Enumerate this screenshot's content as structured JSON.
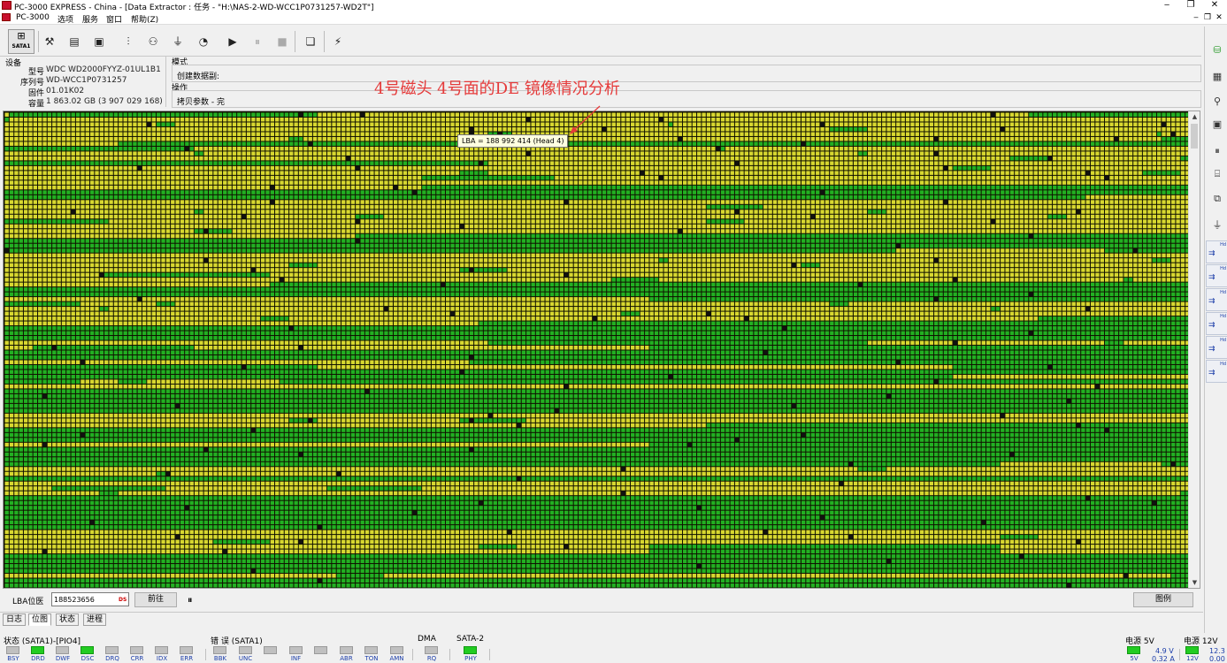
{
  "window": {
    "title": "PC-3000 EXPRESS - China - [Data Extractor : 任务 - \"H:\\NAS-2-WD-WCC1P0731257-WD2T\"]",
    "controls": [
      "‒",
      "❐",
      "✕"
    ],
    "mdi_controls": [
      "‒",
      "❐",
      "✕"
    ]
  },
  "menu": [
    "PC-3000",
    "选项",
    "服务",
    "窗口",
    "帮助(Z)"
  ],
  "toolbar": {
    "sata_label": "SATA1",
    "buttons": [
      "sata-port",
      "tools",
      "bios",
      "100-percent",
      "drive-pin",
      "search",
      "jumper",
      "disk-image",
      "play",
      "pause",
      "stop",
      "window-list",
      "run-script"
    ]
  },
  "device": {
    "header": "设备",
    "rows": [
      {
        "label": "型号",
        "value": "WDC WD2000FYYZ-01UL1B1"
      },
      {
        "label": "序列号",
        "value": "WD-WCC1P0731257"
      },
      {
        "label": "固件",
        "value": "01.01K02"
      },
      {
        "label": "容量",
        "value": "1 863.02 GB (3 907 029 168)"
      }
    ]
  },
  "mode": {
    "header": "模式",
    "value": "创建数据副:"
  },
  "operation": {
    "header": "操作",
    "value": "拷贝参数 - 完"
  },
  "annotation": "4号磁头 4号面的DE 镜像情况分析",
  "tooltip": "LBA =  188 992 414 (Head 4)",
  "sector_map": {
    "columns": 250,
    "rows": 98,
    "legend": {
      "read_ok": "#d8d830",
      "read_green": "#22b022",
      "bad": "#111111",
      "grid": "#101000"
    },
    "green_runs": [
      [
        0,
        1,
        66
      ],
      [
        0,
        216,
        250
      ],
      [
        1,
        0,
        1
      ],
      [
        2,
        32,
        36
      ],
      [
        2,
        140,
        141
      ],
      [
        3,
        174,
        182
      ],
      [
        4,
        102,
        107
      ],
      [
        4,
        243,
        244
      ],
      [
        5,
        60,
        63
      ],
      [
        5,
        244,
        250
      ],
      [
        6,
        24,
        250
      ],
      [
        7,
        0,
        40
      ],
      [
        7,
        151,
        152
      ],
      [
        8,
        40,
        42
      ],
      [
        8,
        180,
        182
      ],
      [
        9,
        212,
        220
      ],
      [
        9,
        248,
        250
      ],
      [
        10,
        0,
        102
      ],
      [
        11,
        200,
        208
      ],
      [
        12,
        96,
        102
      ],
      [
        12,
        240,
        248
      ],
      [
        13,
        88,
        116
      ],
      [
        15,
        88,
        250
      ],
      [
        16,
        0,
        250
      ],
      [
        17,
        0,
        228
      ],
      [
        19,
        148,
        160
      ],
      [
        20,
        40,
        42
      ],
      [
        20,
        182,
        186
      ],
      [
        21,
        74,
        80
      ],
      [
        21,
        220,
        224
      ],
      [
        22,
        0,
        22
      ],
      [
        22,
        148,
        156
      ],
      [
        24,
        40,
        48
      ],
      [
        25,
        74,
        250
      ],
      [
        26,
        0,
        250
      ],
      [
        27,
        0,
        250
      ],
      [
        28,
        0,
        188
      ],
      [
        28,
        232,
        250
      ],
      [
        30,
        138,
        140
      ],
      [
        30,
        242,
        246
      ],
      [
        31,
        60,
        66
      ],
      [
        31,
        168,
        172
      ],
      [
        32,
        96,
        106
      ],
      [
        33,
        20,
        56
      ],
      [
        34,
        128,
        138
      ],
      [
        34,
        236,
        238
      ],
      [
        35,
        56,
        250
      ],
      [
        36,
        0,
        250
      ],
      [
        37,
        0,
        250
      ],
      [
        38,
        136,
        250
      ],
      [
        39,
        0,
        16
      ],
      [
        39,
        32,
        36
      ],
      [
        39,
        174,
        178
      ],
      [
        40,
        20,
        22
      ],
      [
        40,
        208,
        210
      ],
      [
        41,
        130,
        134
      ],
      [
        42,
        54,
        60
      ],
      [
        42,
        218,
        250
      ],
      [
        43,
        100,
        250
      ],
      [
        44,
        0,
        250
      ],
      [
        45,
        0,
        250
      ],
      [
        46,
        0,
        250
      ],
      [
        47,
        102,
        182
      ],
      [
        47,
        232,
        236
      ],
      [
        48,
        6,
        40
      ],
      [
        48,
        136,
        250
      ],
      [
        49,
        0,
        250
      ],
      [
        50,
        0,
        250
      ],
      [
        51,
        98,
        250
      ],
      [
        52,
        0,
        66
      ],
      [
        52,
        200,
        250
      ],
      [
        53,
        0,
        250
      ],
      [
        54,
        0,
        200
      ],
      [
        55,
        0,
        16
      ],
      [
        55,
        24,
        30
      ],
      [
        55,
        58,
        250
      ],
      [
        57,
        0,
        250
      ],
      [
        58,
        0,
        250
      ],
      [
        59,
        0,
        250
      ],
      [
        60,
        0,
        250
      ],
      [
        61,
        0,
        250
      ],
      [
        63,
        60,
        66
      ],
      [
        63,
        96,
        110
      ],
      [
        64,
        148,
        250
      ],
      [
        65,
        0,
        250
      ],
      [
        66,
        0,
        250
      ],
      [
        67,
        0,
        250
      ],
      [
        68,
        136,
        250
      ],
      [
        69,
        0,
        250
      ],
      [
        70,
        0,
        250
      ],
      [
        71,
        0,
        250
      ],
      [
        72,
        0,
        210
      ],
      [
        72,
        244,
        250
      ],
      [
        73,
        180,
        186
      ],
      [
        74,
        32,
        34
      ],
      [
        75,
        0,
        250
      ],
      [
        77,
        10,
        34
      ],
      [
        77,
        68,
        88
      ],
      [
        78,
        20,
        24
      ],
      [
        78,
        248,
        250
      ],
      [
        79,
        0,
        250
      ],
      [
        80,
        0,
        250
      ],
      [
        81,
        0,
        250
      ],
      [
        82,
        0,
        250
      ],
      [
        83,
        0,
        250
      ],
      [
        84,
        0,
        250
      ],
      [
        85,
        0,
        250
      ],
      [
        87,
        210,
        218
      ],
      [
        88,
        44,
        56
      ],
      [
        89,
        100,
        108
      ],
      [
        89,
        136,
        210
      ],
      [
        90,
        136,
        210
      ],
      [
        91,
        0,
        250
      ],
      [
        92,
        0,
        250
      ],
      [
        93,
        0,
        250
      ],
      [
        94,
        0,
        250
      ],
      [
        95,
        70,
        80
      ],
      [
        95,
        246,
        250
      ],
      [
        96,
        0,
        250
      ],
      [
        97,
        0,
        250
      ]
    ],
    "bad_cells": [
      [
        0,
        62
      ],
      [
        0,
        75
      ],
      [
        0,
        208
      ],
      [
        1,
        110
      ],
      [
        1,
        138
      ],
      [
        2,
        30
      ],
      [
        2,
        172
      ],
      [
        2,
        244
      ],
      [
        3,
        98
      ],
      [
        3,
        126
      ],
      [
        3,
        210
      ],
      [
        4,
        98
      ],
      [
        4,
        104
      ],
      [
        4,
        246
      ],
      [
        5,
        142
      ],
      [
        5,
        196
      ],
      [
        5,
        234
      ],
      [
        6,
        64
      ],
      [
        6,
        168
      ],
      [
        7,
        38
      ],
      [
        7,
        150
      ],
      [
        8,
        110
      ],
      [
        8,
        196
      ],
      [
        9,
        72
      ],
      [
        9,
        220
      ],
      [
        10,
        100
      ],
      [
        10,
        154
      ],
      [
        11,
        28
      ],
      [
        11,
        74
      ],
      [
        11,
        198
      ],
      [
        12,
        134
      ],
      [
        12,
        228
      ],
      [
        13,
        138
      ],
      [
        13,
        232
      ],
      [
        15,
        56
      ],
      [
        15,
        82
      ],
      [
        16,
        86
      ],
      [
        16,
        172
      ],
      [
        18,
        56
      ],
      [
        18,
        118
      ],
      [
        18,
        198
      ],
      [
        20,
        14
      ],
      [
        20,
        154
      ],
      [
        20,
        226
      ],
      [
        21,
        50
      ],
      [
        21,
        170
      ],
      [
        22,
        74
      ],
      [
        22,
        208
      ],
      [
        23,
        96
      ],
      [
        24,
        42
      ],
      [
        24,
        142
      ],
      [
        25,
        216
      ],
      [
        26,
        74
      ],
      [
        27,
        188
      ],
      [
        28,
        0
      ],
      [
        28,
        238
      ],
      [
        30,
        42
      ],
      [
        30,
        196
      ],
      [
        31,
        166
      ],
      [
        32,
        52
      ],
      [
        32,
        98
      ],
      [
        33,
        20
      ],
      [
        33,
        118
      ],
      [
        34,
        58
      ],
      [
        34,
        200
      ],
      [
        35,
        92
      ],
      [
        35,
        180
      ],
      [
        37,
        216
      ],
      [
        38,
        28
      ],
      [
        38,
        196
      ],
      [
        40,
        80
      ],
      [
        40,
        228
      ],
      [
        41,
        94
      ],
      [
        41,
        148
      ],
      [
        42,
        124
      ],
      [
        42,
        156
      ],
      [
        44,
        60
      ],
      [
        44,
        164
      ],
      [
        45,
        216
      ],
      [
        47,
        200
      ],
      [
        48,
        10
      ],
      [
        48,
        62
      ],
      [
        49,
        160
      ],
      [
        50,
        98
      ],
      [
        51,
        16
      ],
      [
        51,
        188
      ],
      [
        52,
        50
      ],
      [
        52,
        220
      ],
      [
        53,
        96
      ],
      [
        54,
        140
      ],
      [
        55,
        196
      ],
      [
        56,
        118
      ],
      [
        56,
        230
      ],
      [
        57,
        76
      ],
      [
        58,
        8
      ],
      [
        58,
        186
      ],
      [
        59,
        224
      ],
      [
        60,
        36
      ],
      [
        60,
        166
      ],
      [
        61,
        116
      ],
      [
        62,
        102
      ],
      [
        62,
        210
      ],
      [
        63,
        64
      ],
      [
        63,
        98
      ],
      [
        64,
        108
      ],
      [
        64,
        226
      ],
      [
        65,
        52
      ],
      [
        65,
        232
      ],
      [
        66,
        16
      ],
      [
        66,
        168
      ],
      [
        67,
        154
      ],
      [
        68,
        8
      ],
      [
        68,
        144
      ],
      [
        69,
        42
      ],
      [
        69,
        98
      ],
      [
        70,
        212
      ],
      [
        70,
        62
      ],
      [
        72,
        178
      ],
      [
        72,
        246
      ],
      [
        73,
        130
      ],
      [
        74,
        70
      ],
      [
        74,
        34
      ],
      [
        75,
        108
      ],
      [
        76,
        176
      ],
      [
        78,
        130
      ],
      [
        79,
        228
      ],
      [
        80,
        100
      ],
      [
        80,
        242
      ],
      [
        81,
        38
      ],
      [
        81,
        146
      ],
      [
        82,
        86
      ],
      [
        83,
        172
      ],
      [
        84,
        18
      ],
      [
        84,
        206
      ],
      [
        85,
        66
      ],
      [
        86,
        106
      ],
      [
        86,
        160
      ],
      [
        87,
        36
      ],
      [
        87,
        178
      ],
      [
        88,
        62
      ],
      [
        88,
        226
      ],
      [
        89,
        118
      ],
      [
        90,
        8
      ],
      [
        90,
        46
      ],
      [
        91,
        214
      ],
      [
        92,
        186
      ],
      [
        93,
        146
      ],
      [
        94,
        52
      ],
      [
        95,
        236
      ],
      [
        96,
        66
      ],
      [
        97,
        224
      ]
    ]
  },
  "lba_bar": {
    "label": "LBA位医",
    "value": "188523656",
    "ds": "DS",
    "goto_label": "前往",
    "legend_label": "图例"
  },
  "tabs": [
    "日志",
    "位图",
    "状态",
    "进程"
  ],
  "status": {
    "state_title": "状态 (SATA1)-[PIO4]",
    "state_leds": [
      {
        "label": "BSY",
        "on": false
      },
      {
        "label": "DRD",
        "on": true
      },
      {
        "label": "DWF",
        "on": false
      },
      {
        "label": "DSC",
        "on": true
      },
      {
        "label": "DRQ",
        "on": false
      },
      {
        "label": "CRR",
        "on": false
      },
      {
        "label": "IDX",
        "on": false
      },
      {
        "label": "ERR",
        "on": false
      }
    ],
    "error_title": "错 误 (SATA1)",
    "error_leds": [
      {
        "label": "BBK",
        "on": false
      },
      {
        "label": "UNC",
        "on": false
      },
      {
        "label": "",
        "on": false
      },
      {
        "label": "INF",
        "on": false
      },
      {
        "label": "",
        "on": false
      },
      {
        "label": "ABR",
        "on": false
      },
      {
        "label": "TON",
        "on": false
      },
      {
        "label": "AMN",
        "on": false
      }
    ],
    "dma_title": "DMA",
    "dma_led": {
      "label": "RQ",
      "on": false
    },
    "sata_title": "SATA-2",
    "sata_led": {
      "label": "PHY",
      "on": true
    },
    "power5_title": "电源 5V",
    "power5_led": "5V",
    "power5_volt": "4.9 V",
    "power5_amp": "0.32 A",
    "power12_title": "电源 12V",
    "power12_led": "12V",
    "power12_volt": "12.3",
    "power12_amp": "0.00"
  },
  "right_panel": {
    "head_label": "Hd",
    "heads": 6
  }
}
